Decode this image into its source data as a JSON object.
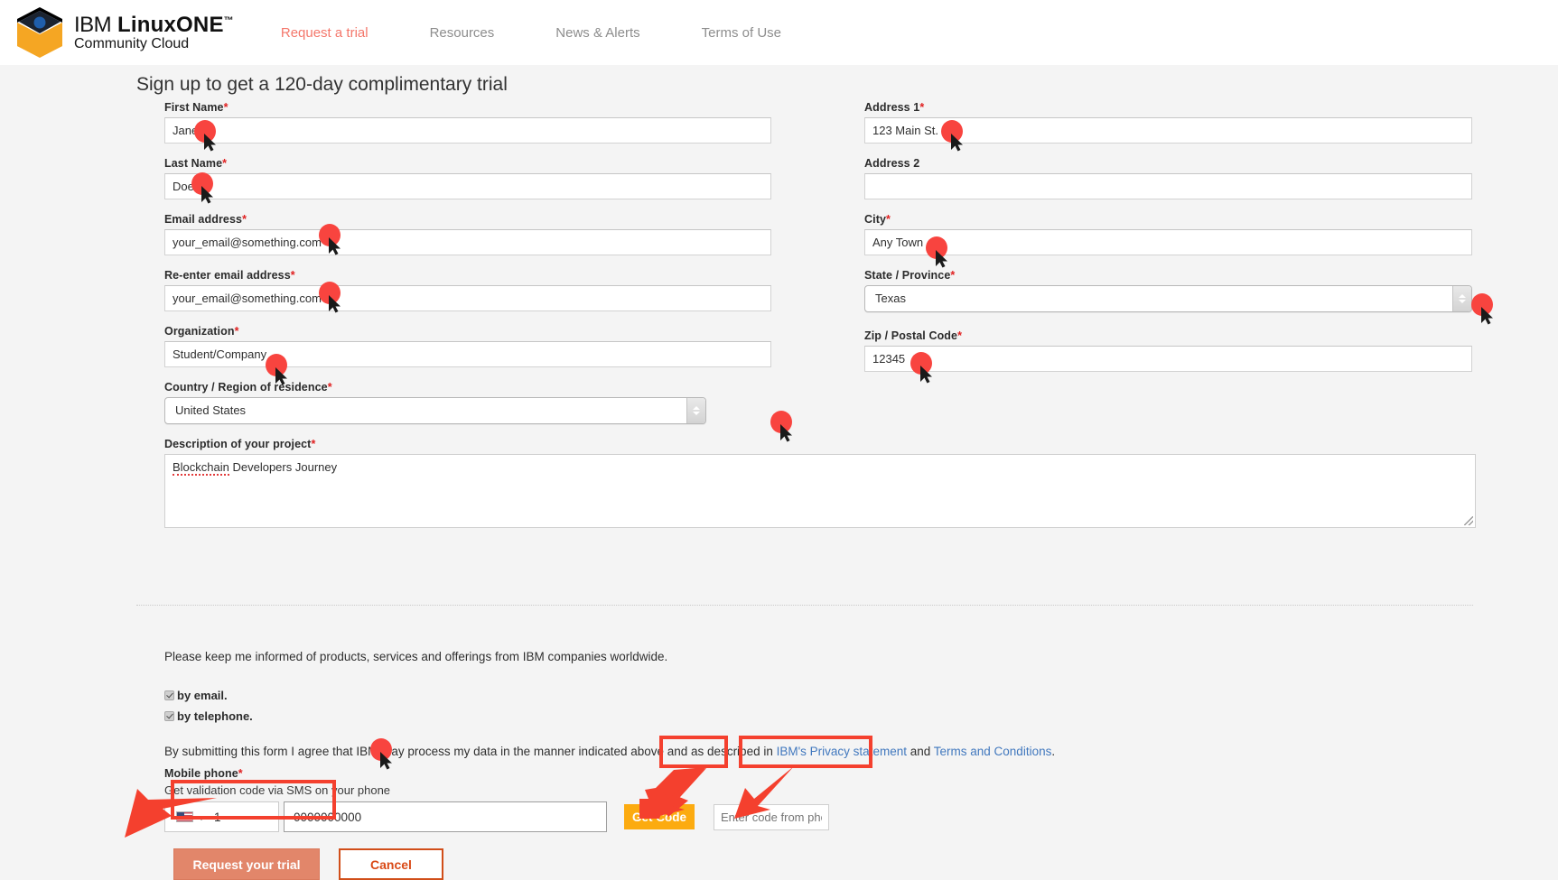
{
  "header": {
    "logo": {
      "brand": "IBM",
      "product": "LinuxONE",
      "tm": "™",
      "subtitle": "Community Cloud",
      "icon": "linuxone-hex-logo"
    },
    "nav": [
      {
        "label": "Request a trial",
        "active": true
      },
      {
        "label": "Resources",
        "active": false
      },
      {
        "label": "News & Alerts",
        "active": false
      },
      {
        "label": "Terms of Use",
        "active": false
      }
    ],
    "accent_active": "#f4776b",
    "nav_color": "#8d8d8d"
  },
  "page": {
    "title": "Sign up to get a 120-day complimentary trial"
  },
  "form": {
    "required_mark": "*",
    "left": {
      "first_name": {
        "label": "First Name",
        "value": "Jane",
        "placeholder": ""
      },
      "last_name": {
        "label": "Last Name",
        "value": "Doe",
        "placeholder": ""
      },
      "email": {
        "label": "Email address",
        "value": "your_email@something.com",
        "placeholder": ""
      },
      "email_confirm": {
        "label": "Re-enter email address",
        "value": "your_email@something.com",
        "placeholder": ""
      },
      "organization": {
        "label": "Organization",
        "value": "Student/Company",
        "placeholder": ""
      },
      "country": {
        "label": "Country / Region of residence",
        "value": "United States"
      },
      "description": {
        "label": "Description of your project",
        "value": "Blockchain Developers Journey",
        "misspelled_word": "Blockchain",
        "rest": " Developers Journey"
      }
    },
    "right": {
      "address1": {
        "label": "Address 1",
        "value": "123 Main St."
      },
      "address2": {
        "label": "Address 2",
        "value": ""
      },
      "city": {
        "label": "City",
        "value": "Any Town"
      },
      "state": {
        "label": "State / Province",
        "value": "Texas"
      },
      "zip": {
        "label": "Zip / Postal Code",
        "value": "12345"
      }
    }
  },
  "consent": {
    "intro": "Please keep me informed of products, services and offerings from IBM companies worldwide.",
    "options": [
      {
        "label": "by email.",
        "checked": true
      },
      {
        "label": "by telephone.",
        "checked": true
      }
    ],
    "agreement": {
      "prefix": "By submitting this form I agree that IBM may process my data in the manner indicated above and as described in ",
      "link1": "IBM's Privacy statement",
      "middle": " and ",
      "link2": "Terms and Conditions",
      "suffix": ".",
      "link_color": "#4178be"
    }
  },
  "phone": {
    "label": "Mobile phone",
    "sublabel": "Get validation code via SMS on your phone",
    "country_flag": "us-flag-icon",
    "country_code": "1",
    "number": "0000000000",
    "get_code_button": "Get Code",
    "get_code_color": "#fcab10",
    "code_placeholder": "Enter code from phone"
  },
  "actions": {
    "submit": "Request your trial",
    "submit_color": "#e2866a",
    "cancel": "Cancel",
    "cancel_color": "#d14e19"
  },
  "annotations": {
    "highlight_color": "#f4402e",
    "cursor_color": "#f8443f"
  }
}
